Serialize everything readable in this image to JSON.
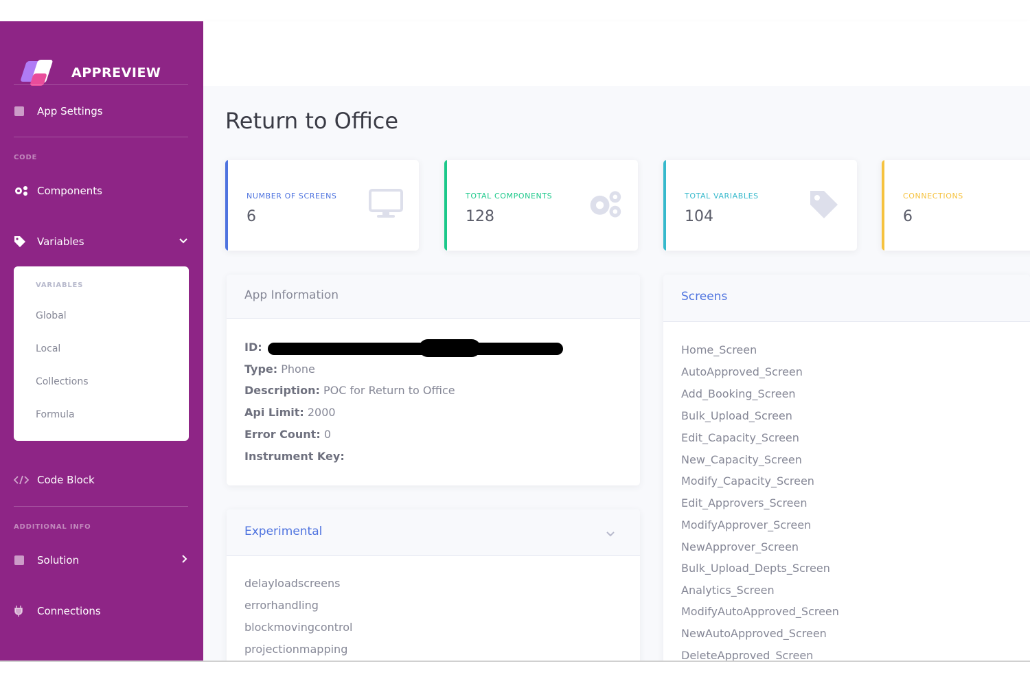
{
  "brand": {
    "name": "APPREVIEW"
  },
  "sidebar": {
    "app_settings": "App Settings",
    "section_code": "CODE",
    "components": "Components",
    "variables": "Variables",
    "variables_panel": {
      "heading": "VARIABLES",
      "items": [
        "Global",
        "Local",
        "Collections",
        "Formula"
      ]
    },
    "code_block": "Code Block",
    "section_additional": "ADDITIONAL INFO",
    "solution": "Solution",
    "connections": "Connections"
  },
  "page": {
    "title": "Return to Office"
  },
  "stats": [
    {
      "label": "NUMBER OF SCREENS",
      "value": "6",
      "color": "#4e73df",
      "icon": "desktop-icon"
    },
    {
      "label": "TOTAL COMPONENTS",
      "value": "128",
      "color": "#1cc88a",
      "icon": "gears-icon"
    },
    {
      "label": "TOTAL VARIABLES",
      "value": "104",
      "color": "#36b9cc",
      "icon": "tag-icon"
    },
    {
      "label": "CONNECTIONS",
      "value": "6",
      "color": "#f6c23e",
      "icon": ""
    }
  ],
  "app_info": {
    "title": "App Information",
    "id_label": "ID:",
    "type_label": "Type:",
    "type_value": "Phone",
    "description_label": "Description:",
    "description_value": "POC for Return to Office",
    "api_limit_label": "Api Limit:",
    "api_limit_value": "2000",
    "error_count_label": "Error Count:",
    "error_count_value": "0",
    "instrument_key_label": "Instrument Key:"
  },
  "experimental": {
    "title": "Experimental",
    "items": [
      "delayloadscreens",
      "errorhandling",
      "blockmovingcontrol",
      "projectionmapping"
    ]
  },
  "screens": {
    "title": "Screens",
    "items": [
      "Home_Screen",
      "AutoApproved_Screen",
      "Add_Booking_Screen",
      "Bulk_Upload_Screen",
      "Edit_Capacity_Screen",
      "New_Capacity_Screen",
      "Modify_Capacity_Screen",
      "Edit_Approvers_Screen",
      "ModifyApprover_Screen",
      "NewApprover_Screen",
      "Bulk_Upload_Depts_Screen",
      "Analytics_Screen",
      "ModifyAutoApproved_Screen",
      "NewAutoApproved_Screen",
      "DeleteApproved_Screen"
    ]
  },
  "colors": {
    "sidebar": "#8e2586",
    "primary": "#4e73df",
    "success": "#1cc88a",
    "info": "#36b9cc",
    "warning": "#f6c23e"
  }
}
